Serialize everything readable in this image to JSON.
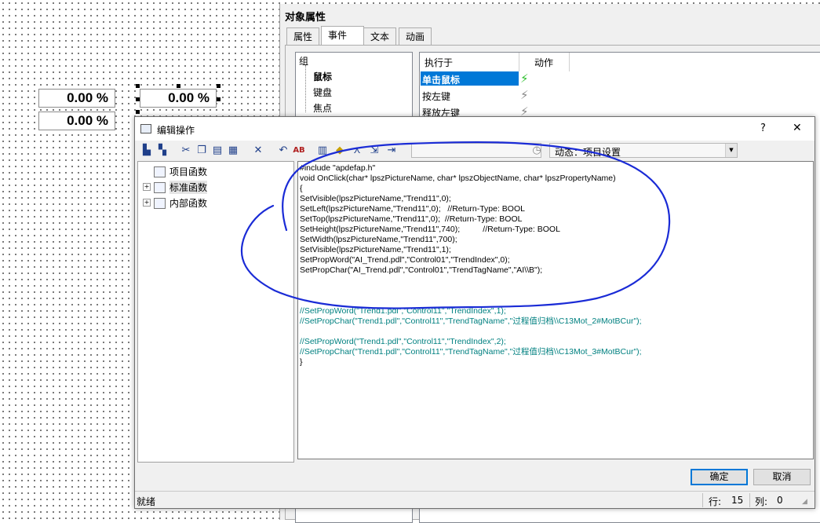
{
  "canvas": {
    "fields": [
      "0.00 %",
      "0.00 %",
      "0.00 %"
    ]
  },
  "properties": {
    "title": "对象属性",
    "tabs": [
      "属性",
      "事件",
      "文本",
      "动画"
    ],
    "tree": {
      "root": "组",
      "children": [
        "鼠标",
        "键盘",
        "焦点"
      ]
    },
    "events": {
      "header_executor": "执行于",
      "header_action": "动作",
      "rows": [
        "单击鼠标",
        "按左键",
        "释放左键"
      ]
    }
  },
  "dialog": {
    "title": "编辑操作",
    "help_label": "?",
    "close_label": "✕",
    "dynamic_label": "动态：项目设置",
    "tree": [
      "项目函数",
      "标准函数",
      "内部函数"
    ],
    "code": [
      {
        "t": "#include \"apdefap.h\"",
        "c": "#000000"
      },
      {
        "t": "void OnClick(char* lpszPictureName, char* lpszObjectName, char* lpszPropertyName)",
        "c": "#000000"
      },
      {
        "t": "{",
        "c": "#000000"
      },
      {
        "t": "SetVisible(lpszPictureName,\"Trend11\",0);",
        "c": "#000000"
      },
      {
        "t": "SetLeft(lpszPictureName,\"Trend11\",0);   //Return-Type: BOOL",
        "c": "#000000"
      },
      {
        "t": "SetTop(lpszPictureName,\"Trend11\",0);  //Return-Type: BOOL",
        "c": "#000000"
      },
      {
        "t": "SetHeight(lpszPictureName,\"Trend11\",740);          //Return-Type: BOOL",
        "c": "#000000"
      },
      {
        "t": "SetWidth(lpszPictureName,\"Trend11\",700);",
        "c": "#000000"
      },
      {
        "t": "SetVisible(lpszPictureName,\"Trend11\",1);",
        "c": "#000000"
      },
      {
        "t": "SetPropWord(\"AI_Trend.pdl\",\"Control01\",\"TrendIndex\",0);",
        "c": "#000000"
      },
      {
        "t": "SetPropChar(\"AI_Trend.pdl\",\"Control01\",\"TrendTagName\",\"AI\\\\B\");",
        "c": "#000000"
      },
      {
        "t": "",
        "c": "#000000"
      },
      {
        "t": "",
        "c": "#000000"
      },
      {
        "t": "",
        "c": "#000000"
      },
      {
        "t": "//SetPropWord(\"Trend1.pdl\",\"Control11\",\"TrendIndex\",1);",
        "c": "#008080"
      },
      {
        "t": "//SetPropChar(\"Trend1.pdl\",\"Control11\",\"TrendTagName\",\"过程值归档\\\\C13Mot_2#MotBCur\");",
        "c": "#008080"
      },
      {
        "t": "",
        "c": "#000000"
      },
      {
        "t": "//SetPropWord(\"Trend1.pdl\",\"Control11\",\"TrendIndex\",2);",
        "c": "#008080"
      },
      {
        "t": "//SetPropChar(\"Trend1.pdl\",\"Control11\",\"TrendTagName\",\"过程值归档\\\\C13Mot_3#MotBCur\");",
        "c": "#008080"
      },
      {
        "t": "}",
        "c": "#000000"
      }
    ],
    "ok_label": "确定",
    "cancel_label": "取消",
    "status_text": "就绪",
    "row_label": "行:",
    "row_value": "15",
    "col_label": "列:",
    "col_value": "0"
  },
  "colors": {
    "accent": "#0078d7",
    "annotation": "#1a2bd6",
    "selected_row": "#0078d7"
  }
}
